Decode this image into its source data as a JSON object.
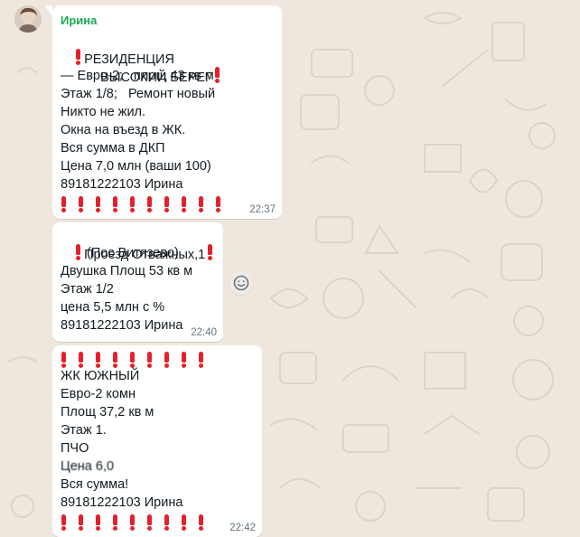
{
  "chat": {
    "messages": [
      {
        "sender": "Ирина",
        "lines": [
          "РЕЗИДЕНЦИЯ",
          "ВЫСОКИЙ БЕРЕГ",
          "— Евро-2;   площ 43 кв м",
          "Этаж 1/8;   Ремонт новый",
          "Никто не жил.",
          "Окна на въезд в ЖК.",
          "Вся сумма в ДКП",
          "Цена 7,0 млн (ваши 100)",
          "89181222103 Ирина"
        ],
        "emoji_count": 10,
        "time": "22:37"
      },
      {
        "lines": [
          "Проезд Отважных,1",
          "(Пос Витязево)",
          "Двушка Площ 53 кв м",
          "Этаж 1/2",
          "цена 5,5 млн с %",
          "89181222103 Ирина"
        ],
        "time": "22:40"
      },
      {
        "emoji_count": 9,
        "lines": [
          "ЖК ЮЖНЫЙ",
          "Евро-2 комн",
          "Площ 37,2 кв м",
          "Этаж 1.",
          "ПЧО",
          "Цена 6,0",
          "Вся сумма!",
          "89181222103 Ирина"
        ],
        "emoji_count_bottom": 9,
        "time": "22:42"
      }
    ]
  },
  "colors": {
    "wallpaper": "#efe7dd",
    "bubble": "#ffffff",
    "sender_name": "#1fa855",
    "timestamp": "#667781",
    "exclamation_emoji": "#e5202b"
  },
  "icons": {
    "avatar": "contact-avatar-photo",
    "emoji": "red-exclamation-emoji",
    "react": "smiley-react-icon"
  }
}
